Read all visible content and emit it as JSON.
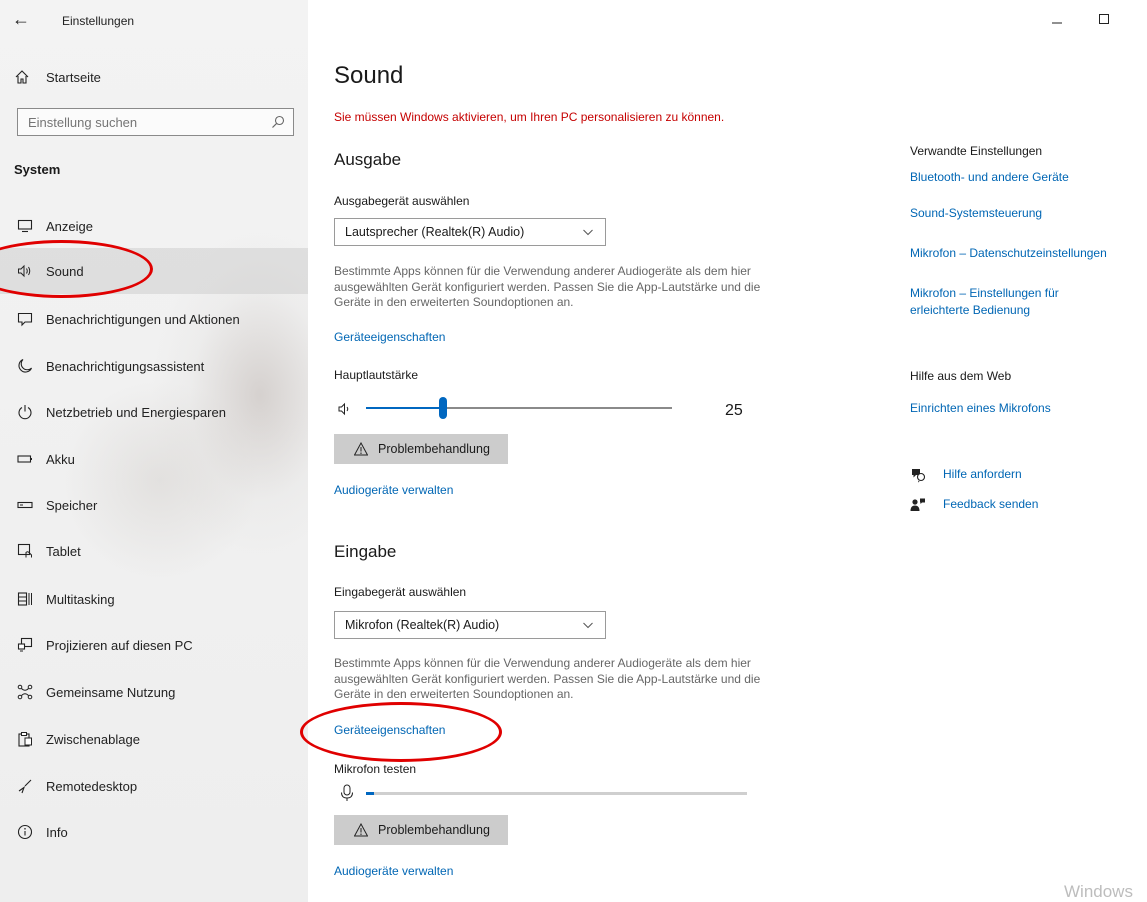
{
  "window": {
    "title": "Einstellungen"
  },
  "sidebar": {
    "home_label": "Startseite",
    "search_placeholder": "Einstellung suchen",
    "section": "System",
    "items": [
      {
        "label": "Anzeige",
        "icon": "monitor-icon"
      },
      {
        "label": "Sound",
        "icon": "speaker-icon",
        "selected": true
      },
      {
        "label": "Benachrichtigungen und Aktionen",
        "icon": "notification-icon"
      },
      {
        "label": "Benachrichtigungsassistent",
        "icon": "moon-icon"
      },
      {
        "label": "Netzbetrieb und Energiesparen",
        "icon": "power-icon"
      },
      {
        "label": "Akku",
        "icon": "battery-icon"
      },
      {
        "label": "Speicher",
        "icon": "storage-icon"
      },
      {
        "label": "Tablet",
        "icon": "tablet-icon"
      },
      {
        "label": "Multitasking",
        "icon": "multitasking-icon"
      },
      {
        "label": "Projizieren auf diesen PC",
        "icon": "projector-icon"
      },
      {
        "label": "Gemeinsame Nutzung",
        "icon": "share-icon"
      },
      {
        "label": "Zwischenablage",
        "icon": "clipboard-icon"
      },
      {
        "label": "Remotedesktop",
        "icon": "remote-icon"
      },
      {
        "label": "Info",
        "icon": "info-icon"
      }
    ]
  },
  "main": {
    "title": "Sound",
    "activation_warning": "Sie müssen Windows aktivieren, um Ihren PC personalisieren zu können.",
    "output": {
      "heading": "Ausgabe",
      "device_label": "Ausgabegerät auswählen",
      "device_value": "Lautsprecher (Realtek(R) Audio)",
      "description": "Bestimmte Apps können für die Verwendung anderer Audiogeräte als dem hier ausgewählten Gerät konfiguriert werden. Passen Sie die App-Lautstärke und die Geräte in den erweiterten Soundoptionen an.",
      "properties_link": "Geräteeigenschaften",
      "volume_label": "Hauptlautstärke",
      "volume_value": "25",
      "volume_fraction": 0.25,
      "troubleshoot_button": "Problembehandlung",
      "manage_link": "Audiogeräte verwalten"
    },
    "input": {
      "heading": "Eingabe",
      "device_label": "Eingabegerät auswählen",
      "device_value": "Mikrofon (Realtek(R) Audio)",
      "description": "Bestimmte Apps können für die Verwendung anderer Audiogeräte als dem hier ausgewählten Gerät konfiguriert werden. Passen Sie die App-Lautstärke und die Geräte in den erweiterten Soundoptionen an.",
      "properties_link": "Geräteeigenschaften",
      "test_label": "Mikrofon testen",
      "mic_level_fraction": 0.02,
      "troubleshoot_button": "Problembehandlung",
      "manage_link": "Audiogeräte verwalten"
    }
  },
  "related": {
    "heading": "Verwandte Einstellungen",
    "links": [
      "Bluetooth- und andere Geräte",
      "Sound-Systemsteuerung",
      "Mikrofon – Datenschutzeinstellungen",
      "Mikrofon – Einstellungen für erleichterte Bedienung"
    ],
    "web_heading": "Hilfe aus dem Web",
    "web_link": "Einrichten eines Mikrofons",
    "help_link": "Hilfe anfordern",
    "feedback_link": "Feedback senden"
  },
  "watermark": "Windows",
  "colors": {
    "accent": "#0067c0",
    "link": "#0066b4",
    "warning": "#c50000",
    "annotation": "#e00000"
  }
}
